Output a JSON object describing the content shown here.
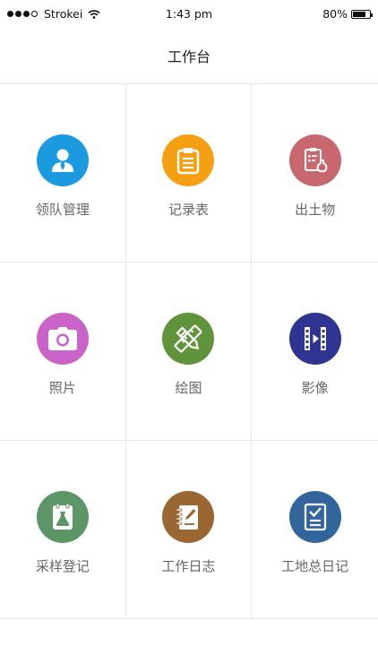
{
  "status_bar": {
    "carrier": "Strokei",
    "time": "1:43 pm",
    "battery": "80%"
  },
  "nav": {
    "title": "工作台"
  },
  "tiles": [
    {
      "label": "领队管理",
      "icon": "person-icon",
      "color": "#1b9ae0"
    },
    {
      "label": "记录表",
      "icon": "clipboard-icon",
      "color": "#f5a012"
    },
    {
      "label": "出土物",
      "icon": "artifact-icon",
      "color": "#c9676e"
    },
    {
      "label": "照片",
      "icon": "camera-icon",
      "color": "#c963c8"
    },
    {
      "label": "绘图",
      "icon": "drawing-tools-icon",
      "color": "#5f943d"
    },
    {
      "label": "影像",
      "icon": "film-icon",
      "color": "#2f3391"
    },
    {
      "label": "采样登记",
      "icon": "sample-flask-icon",
      "color": "#5c9667"
    },
    {
      "label": "工作日志",
      "icon": "notebook-icon",
      "color": "#9a6631"
    },
    {
      "label": "工地总日记",
      "icon": "checklist-icon",
      "color": "#31659b"
    }
  ]
}
